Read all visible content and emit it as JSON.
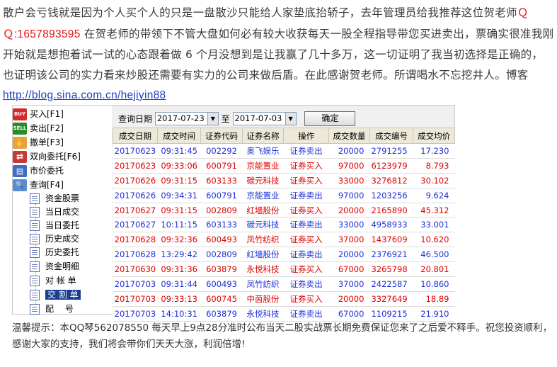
{
  "intro": {
    "part1": "散户会亏钱就是因为个人买个人的只是一盘散沙只能给人家垫底抬轿子，去年管理员给我推荐这位贺老师",
    "qq_label": "Ｑ Ｑ",
    "qq_number": ":1657893595",
    "part2": " 在贺老师的带领下不管大盘如何必有较大收获每天一股全程指导带您买进卖出，票确实很准我刚开始就是想抱着试一试的心态跟着做 6 个月没想到是让我赢了几十多万，这一切证明了我当初选择是正确的，也证明该公司的实力看来炒股还需要有实力的公司来做后盾。在此感谢贺老师。所谓喝水不忘挖井人。博客",
    "blog_url": "http://blog.sina.com.cn/hejiyin88"
  },
  "menu": {
    "items": [
      {
        "label": "买入[F1]",
        "icon": "buy-icon",
        "badge": "BUY"
      },
      {
        "label": "卖出[F2]",
        "icon": "sell-icon",
        "badge": "SELL"
      },
      {
        "label": "撤单[F3]",
        "icon": "cancel-order-icon",
        "badge": "✋"
      },
      {
        "label": "双向委托[F6]",
        "icon": "two-way-order-icon",
        "badge": "⇄"
      },
      {
        "label": "市价委托",
        "icon": "market-order-icon",
        "badge": "▤"
      },
      {
        "label": "查询[F4]",
        "icon": "query-icon",
        "badge": "🔍"
      }
    ],
    "sub_items": [
      {
        "label": "资金股票"
      },
      {
        "label": "当日成交"
      },
      {
        "label": "当日委托"
      },
      {
        "label": "历史成交"
      },
      {
        "label": "历史委托"
      },
      {
        "label": "资金明细"
      },
      {
        "label": "对 帐 单"
      },
      {
        "label": "交 割 单"
      },
      {
        "label": "配　 号"
      }
    ]
  },
  "query": {
    "date_label": "查询日期",
    "start_date": "2017-07-23",
    "to_label": "至",
    "end_date": "2017-07-03",
    "ok_label": "确定"
  },
  "table": {
    "headers": [
      "成交日期",
      "成交时间",
      "证券代码",
      "证券名称",
      "操作",
      "成交数量",
      "成交编号",
      "成交均价"
    ],
    "rows": [
      {
        "type": "sell",
        "cells": [
          "20170623",
          "09:31:45",
          "002292",
          "奥飞娱乐",
          "证券卖出",
          "20000",
          "2791255",
          "17.230"
        ]
      },
      {
        "type": "buy",
        "cells": [
          "20170623",
          "09:33:06",
          "600791",
          "京能置业",
          "证券买入",
          "97000",
          "6123979",
          "8.793"
        ]
      },
      {
        "type": "buy",
        "cells": [
          "20170626",
          "09:31:15",
          "603133",
          "碳元科技",
          "证券买入",
          "33000",
          "3276812",
          "30.102"
        ]
      },
      {
        "type": "sell",
        "cells": [
          "20170626",
          "09:34:31",
          "600791",
          "京能置业",
          "证券卖出",
          "97000",
          "1203256",
          "9.624"
        ]
      },
      {
        "type": "buy",
        "cells": [
          "20170627",
          "09:31:15",
          "002809",
          "红墙股份",
          "证券买入",
          "20000",
          "2165890",
          "45.312"
        ]
      },
      {
        "type": "sell",
        "cells": [
          "20170627",
          "10:11:15",
          "603133",
          "碳元科技",
          "证券卖出",
          "33000",
          "4958933",
          "33.001"
        ]
      },
      {
        "type": "buy",
        "cells": [
          "20170628",
          "09:32:36",
          "600493",
          "凤竹纺织",
          "证券买入",
          "37000",
          "1437609",
          "10.620"
        ]
      },
      {
        "type": "sell",
        "cells": [
          "20170628",
          "13:29:42",
          "002809",
          "红墙股份",
          "证券卖出",
          "20000",
          "2376921",
          "46.500"
        ]
      },
      {
        "type": "buy",
        "cells": [
          "20170630",
          "09:31:36",
          "603879",
          "永悦科技",
          "证券买入",
          "67000",
          "3265798",
          "20.801"
        ]
      },
      {
        "type": "sell",
        "cells": [
          "20170703",
          "09:31:44",
          "600493",
          "凤竹纺织",
          "证券卖出",
          "37000",
          "2422587",
          "10.860"
        ]
      },
      {
        "type": "buy",
        "cells": [
          "20170703",
          "09:33:13",
          "600745",
          "中茵股份",
          "证券买入",
          "20000",
          "3327649",
          "18.89"
        ]
      },
      {
        "type": "sell",
        "cells": [
          "20170703",
          "14:10:31",
          "603879",
          "永悦科技",
          "证券卖出",
          "67000",
          "1109215",
          "21.910"
        ]
      }
    ]
  },
  "footer": {
    "text": "温馨提示：本QQ琴562078550 每天早上9点28分准时公布当天二股实战票长期免费保证您来了之后爱不释手。祝您投资顺利，感谢大家的支持，我们将会带你们天天大涨，利润倍增!"
  },
  "colors": {
    "buy": "#e00000",
    "sell": "#1b2fd8",
    "link": "#1f3fbf",
    "selected": "#1a3d8f"
  }
}
